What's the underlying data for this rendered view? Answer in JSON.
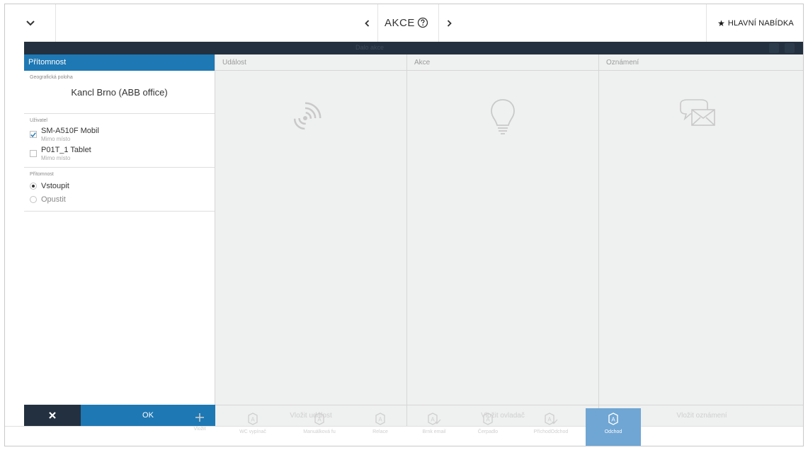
{
  "topbar": {
    "title": "AKCE",
    "main_menu_label": "HLAVNÍ NABÍDKA"
  },
  "darkbar": {
    "text": "Dalo akce"
  },
  "left_panel": {
    "header": "Přítomnost",
    "location": {
      "title": "Geografická poloha",
      "value": "Kancl Brno (ABB office)"
    },
    "users": {
      "title": "Uživatel",
      "items": [
        {
          "name": "SM-A510F Mobil",
          "status": "Mimo místo",
          "checked": true
        },
        {
          "name": "P01T_1 Tablet",
          "status": "Mimo místo",
          "checked": false
        }
      ]
    },
    "presence": {
      "title": "Přítomnost",
      "options": [
        {
          "label": "Vstoupit",
          "selected": true
        },
        {
          "label": "Opustit",
          "selected": false
        }
      ]
    },
    "ok_label": "OK"
  },
  "columns": [
    {
      "header": "Událost",
      "icon": "signal-icon",
      "footer": "Vložit událost"
    },
    {
      "header": "Akce",
      "icon": "lightbulb-icon",
      "footer": "Vložit ovladač"
    },
    {
      "header": "Oznámení",
      "icon": "message-icon",
      "footer": "Vložit oznámení"
    }
  ],
  "toolbar": {
    "items": [
      {
        "label": "Vložit",
        "icon": "plus-icon",
        "active": false
      },
      {
        "label": "WC vypínač",
        "icon": "a-icon",
        "active": false
      },
      {
        "label": "Manuálková fu",
        "icon": "a-icon",
        "active": false
      },
      {
        "label": "Relace",
        "icon": "a-icon",
        "active": false
      },
      {
        "label": "Brnk email",
        "icon": "a-check-icon",
        "active": false
      },
      {
        "label": "Čerpadlo",
        "icon": "a-icon",
        "active": false
      },
      {
        "label": "PříchodOdchod",
        "icon": "a-check-icon",
        "active": false
      },
      {
        "label": "Odchod",
        "icon": "a-icon",
        "active": true
      }
    ]
  },
  "colors": {
    "accent_blue": "#1e78b4",
    "dark_navy": "#23303f",
    "active_tool": "#6fa6d4",
    "column_bg": "#eff0f0"
  }
}
